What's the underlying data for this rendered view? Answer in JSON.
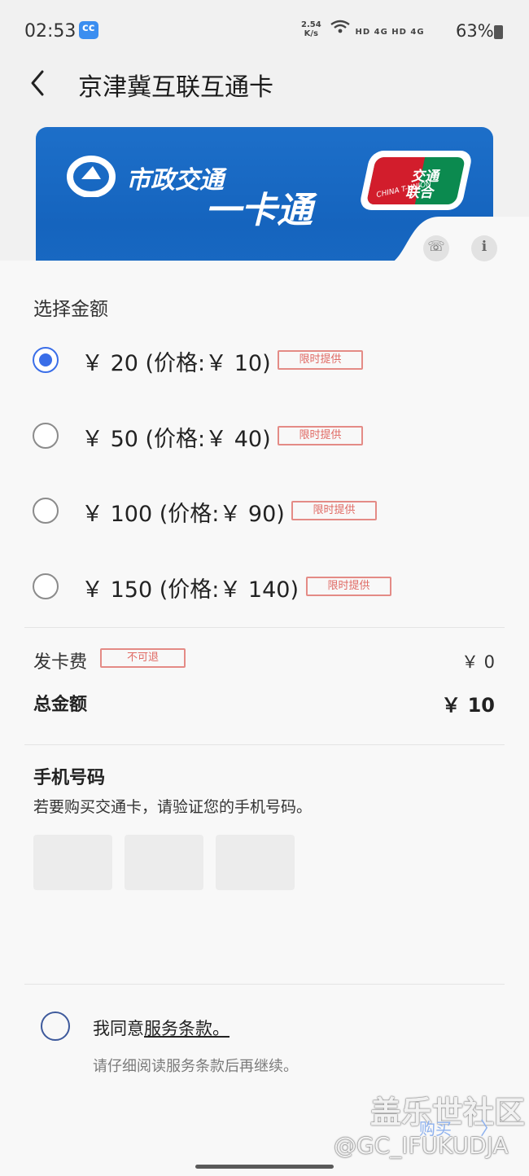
{
  "status_bar": {
    "time": "02:53",
    "net_speed_value": "2.54",
    "net_speed_unit": "K/s",
    "signal_icons": "HD 4G  HD 4G",
    "battery_percent": "63%"
  },
  "header": {
    "title": "京津冀互联互通卡"
  },
  "card": {
    "logo_text_line1": "市政交通",
    "logo_text_line2": "一卡通",
    "badge_line1": "交通",
    "badge_line2": "联合",
    "badge_small": "CHINA T-UNION"
  },
  "amount": {
    "section_title": "选择金额",
    "options": [
      {
        "label": "￥ 20 (价格:￥ 10)",
        "tag": "限时提供",
        "selected": true
      },
      {
        "label": "￥ 50 (价格:￥ 40)",
        "tag": "限时提供",
        "selected": false
      },
      {
        "label": "￥ 100 (价格:￥ 90)",
        "tag": "限时提供",
        "selected": false
      },
      {
        "label": "￥ 150 (价格:￥ 140)",
        "tag": "限时提供",
        "selected": false
      }
    ]
  },
  "fees": {
    "card_fee_label": "发卡费",
    "card_fee_tag": "不可退",
    "card_fee_value": "￥ 0",
    "total_label": "总金额",
    "total_value": "￥ 10"
  },
  "phone": {
    "title": "手机号码",
    "description": "若要购买交通卡，请验证您的手机号码。"
  },
  "agreement": {
    "prefix": "我同意",
    "link": "服务条款。",
    "hint": "请仔细阅读服务条款后再继续。"
  },
  "footer": {
    "buy_label": "购买",
    "buy_arrow": "〉",
    "watermark_line1": "盖乐世社区",
    "watermark_line2": "@GC_IFUKUDJA"
  },
  "colors": {
    "accent": "#3a6ee8",
    "tag_red": "#e06a64",
    "card_blue": "#1564be"
  }
}
